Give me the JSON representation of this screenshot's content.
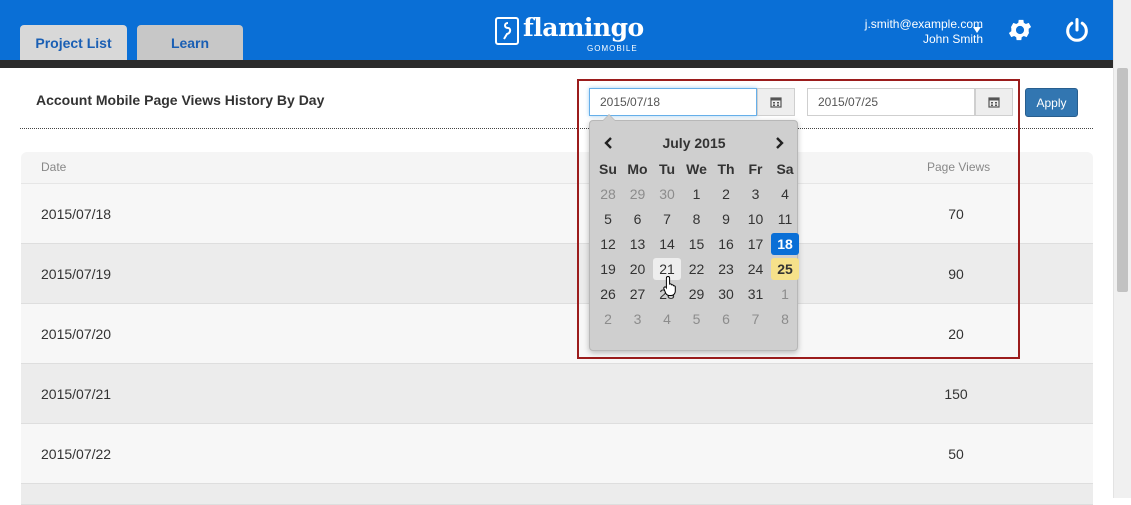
{
  "header": {
    "tabs": [
      {
        "label": "Project List"
      },
      {
        "label": "Learn"
      }
    ],
    "logo": {
      "name": "flamingo",
      "sub": "GOMOBILE"
    },
    "user": {
      "email": "j.smith@example.com",
      "name": "John Smith"
    },
    "icons": {
      "settings": "gear-icon",
      "power": "power-icon",
      "user_menu": "caret-down-icon"
    }
  },
  "page": {
    "title": "Account Mobile Page Views History By Day",
    "start_date": "2015/07/18",
    "end_date": "2015/07/25",
    "apply_label": "Apply"
  },
  "table": {
    "headers": {
      "date": "Date",
      "views": "Page Views"
    },
    "rows": [
      {
        "date": "2015/07/18",
        "views": "70"
      },
      {
        "date": "2015/07/19",
        "views": "90"
      },
      {
        "date": "2015/07/20",
        "views": "20"
      },
      {
        "date": "2015/07/21",
        "views": "150"
      },
      {
        "date": "2015/07/22",
        "views": "50"
      }
    ]
  },
  "datepicker": {
    "title": "July 2015",
    "weekdays": [
      "Su",
      "Mo",
      "Tu",
      "We",
      "Th",
      "Fr",
      "Sa"
    ],
    "weeks": [
      [
        "28",
        "29",
        "30",
        "1",
        "2",
        "3",
        "4"
      ],
      [
        "5",
        "6",
        "7",
        "8",
        "9",
        "10",
        "11"
      ],
      [
        "12",
        "13",
        "14",
        "15",
        "16",
        "17",
        "18"
      ],
      [
        "19",
        "20",
        "21",
        "22",
        "23",
        "24",
        "25"
      ],
      [
        "26",
        "27",
        "28",
        "29",
        "30",
        "31",
        "1"
      ],
      [
        "2",
        "3",
        "4",
        "5",
        "6",
        "7",
        "8"
      ]
    ],
    "selected_day": "18",
    "range_end_day": "25",
    "hover_day": "21"
  },
  "colors": {
    "brand_blue": "#0a6fd6",
    "apply_blue": "#3276b1",
    "highlight_red": "#9b1c1c",
    "range_end_yellow": "#f6e18a"
  }
}
